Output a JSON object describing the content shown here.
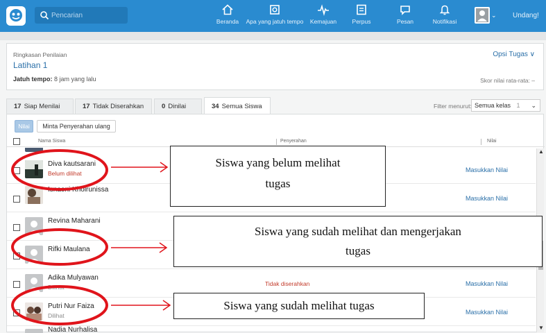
{
  "topbar": {
    "search_placeholder": "Pencarian",
    "nav": [
      {
        "label": "Beranda",
        "icon": "home-icon"
      },
      {
        "label": "Apa yang jatuh tempo",
        "icon": "calendar-icon"
      },
      {
        "label": "Kemajuan",
        "icon": "pulse-icon"
      },
      {
        "label": "Perpus",
        "icon": "library-icon"
      },
      {
        "label": "Pesan",
        "icon": "message-icon"
      },
      {
        "label": "Notifikasi",
        "icon": "bell-icon"
      }
    ],
    "invite_label": "Undang!"
  },
  "summary": {
    "caption": "Ringkasan Penilaian",
    "title": "Latihan 1",
    "due_label": "Jatuh tempo:",
    "due_value": " 8 jam yang lalu",
    "options_label": "Opsi Tugas ∨",
    "avg_score": "Skor nilai rata-rata: –"
  },
  "tabs": [
    {
      "count": "17",
      "label": "Siap Menilai"
    },
    {
      "count": "17",
      "label": "Tidak Diserahkan"
    },
    {
      "count": "0",
      "label": "Dinilai"
    },
    {
      "count": "34",
      "label": "Semua Siswa"
    }
  ],
  "filter": {
    "label": "Filter menurut:",
    "value": "Semua kelas",
    "count": "1"
  },
  "actions": {
    "grade": "Nilai",
    "resubmit": "Minta Penyerahan ulang"
  },
  "table": {
    "headers": {
      "name": "Nama Siswa",
      "submission": "Penyerahan",
      "grade": "Nilai"
    },
    "rows": [
      {
        "name": "Diva kautsarani",
        "status": "Belum dilihat",
        "submission": "",
        "grade": "Masukkan Nilai"
      },
      {
        "name": "Isnaeni Khoirunissa",
        "status": "",
        "submission": "",
        "grade": "Masukkan Nilai"
      },
      {
        "name": "Revina Maharani",
        "status": "",
        "submission": "",
        "grade": ""
      },
      {
        "name": "Rifki Maulana",
        "status": "",
        "submission": "",
        "grade": ""
      },
      {
        "name": "Adika Mulyawan",
        "status": "Dilihat",
        "submission": "Tidak diserahkan",
        "grade": "Masukkan Nilai"
      },
      {
        "name": "Putri Nur Faiza",
        "status": "Dilihat",
        "submission": "",
        "grade": "Masukkan Nilai"
      },
      {
        "name": "Nadia Nurhalisa",
        "status": "",
        "submission": "",
        "grade": ""
      }
    ]
  },
  "annotations": [
    {
      "line1": "Siswa yang belum melihat",
      "line2": "tugas"
    },
    {
      "line1": "Siswa yang sudah  melihat dan mengerjakan",
      "line2": "tugas"
    },
    {
      "line1": "Siswa yang sudah melihat tugas",
      "line2": ""
    }
  ],
  "colors": {
    "brand": "#2a8bd0",
    "link": "#2a6fa8",
    "warn": "#c23a2a",
    "annotation": "#e0141b"
  }
}
